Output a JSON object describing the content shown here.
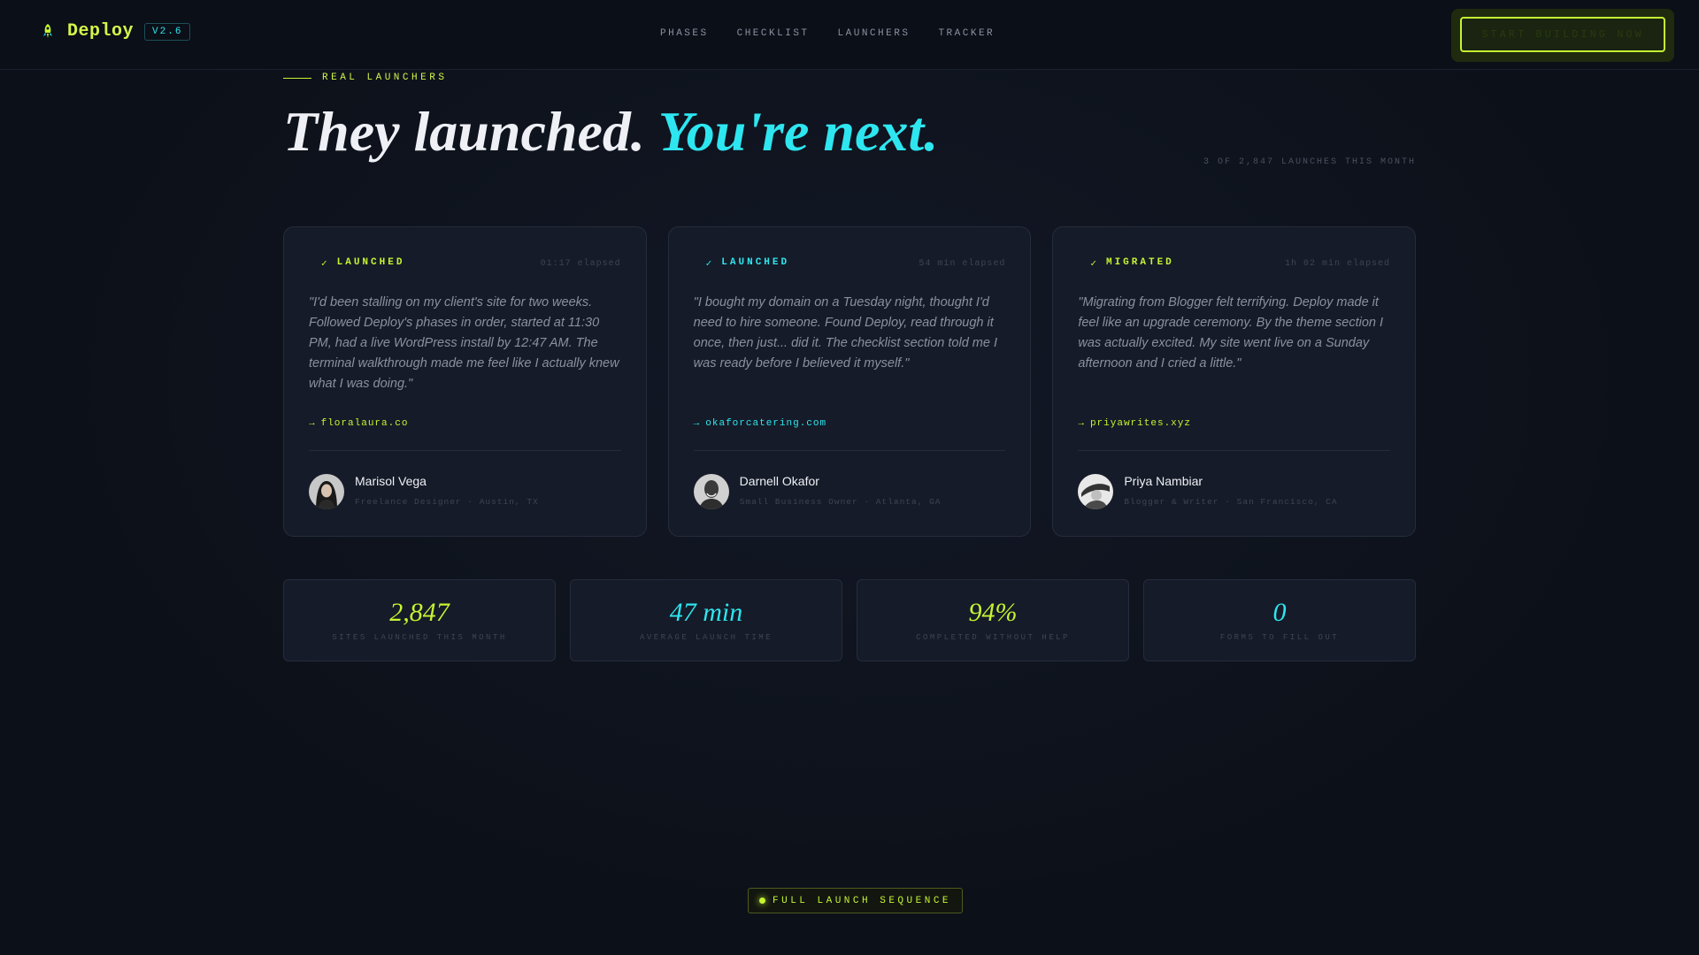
{
  "nav": {
    "brand": "Deploy",
    "version": "V2.6",
    "links": [
      "PHASES",
      "CHECKLIST",
      "LAUNCHERS",
      "TRACKER"
    ],
    "cta": "START BUILDING NOW"
  },
  "header": {
    "eyebrow": "REAL LAUNCHERS",
    "headline_main": "They launched. ",
    "headline_accent": "You're next.",
    "counter": "3 OF 2,847 LAUNCHES THIS MONTH"
  },
  "cards": [
    {
      "status": "LAUNCHED",
      "check": "✓",
      "elapsed": "01:17 elapsed",
      "quote": "\"I'd been stalling on my client's site for two weeks. Followed Deploy's phases in order, started at 11:30 PM, had a live WordPress install by 12:47 AM. The terminal walkthrough made me feel like I actually knew what I was doing.\"",
      "site": "floralaura.co",
      "name": "Marisol Vega",
      "role": "Freelance Designer · Austin, TX"
    },
    {
      "status": "LAUNCHED",
      "check": "✓",
      "elapsed": "54 min elapsed",
      "quote": "\"I bought my domain on a Tuesday night, thought I'd need to hire someone. Found Deploy, read through it once, then just... did it. The checklist section told me I was ready before I believed it myself.\"",
      "site": "okaforcatering.com",
      "name": "Darnell Okafor",
      "role": "Small Business Owner · Atlanta, GA"
    },
    {
      "status": "MIGRATED",
      "check": "✓",
      "elapsed": "1h 02 min elapsed",
      "quote": "\"Migrating from Blogger felt terrifying. Deploy made it feel like an upgrade ceremony. By the theme section I was actually excited. My site went live on a Sunday afternoon and I cried a little.\"",
      "site": "priyawrites.xyz",
      "name": "Priya Nambiar",
      "role": "Blogger & Writer · San Francisco, CA"
    }
  ],
  "arrow": "→",
  "stats": [
    {
      "value": "2,847",
      "label": "SITES LAUNCHED THIS MONTH"
    },
    {
      "value": "47 min",
      "label": "AVERAGE LAUNCH TIME"
    },
    {
      "value": "94%",
      "label": "COMPLETED WITHOUT HELP"
    },
    {
      "value": "0",
      "label": "FORMS TO FILL OUT"
    }
  ],
  "sequence": "FULL LAUNCH SEQUENCE",
  "colors": {
    "lime": "#c6f432",
    "cyan": "#2ee6f0",
    "bg": "#0d111a",
    "card": "#151b28"
  }
}
